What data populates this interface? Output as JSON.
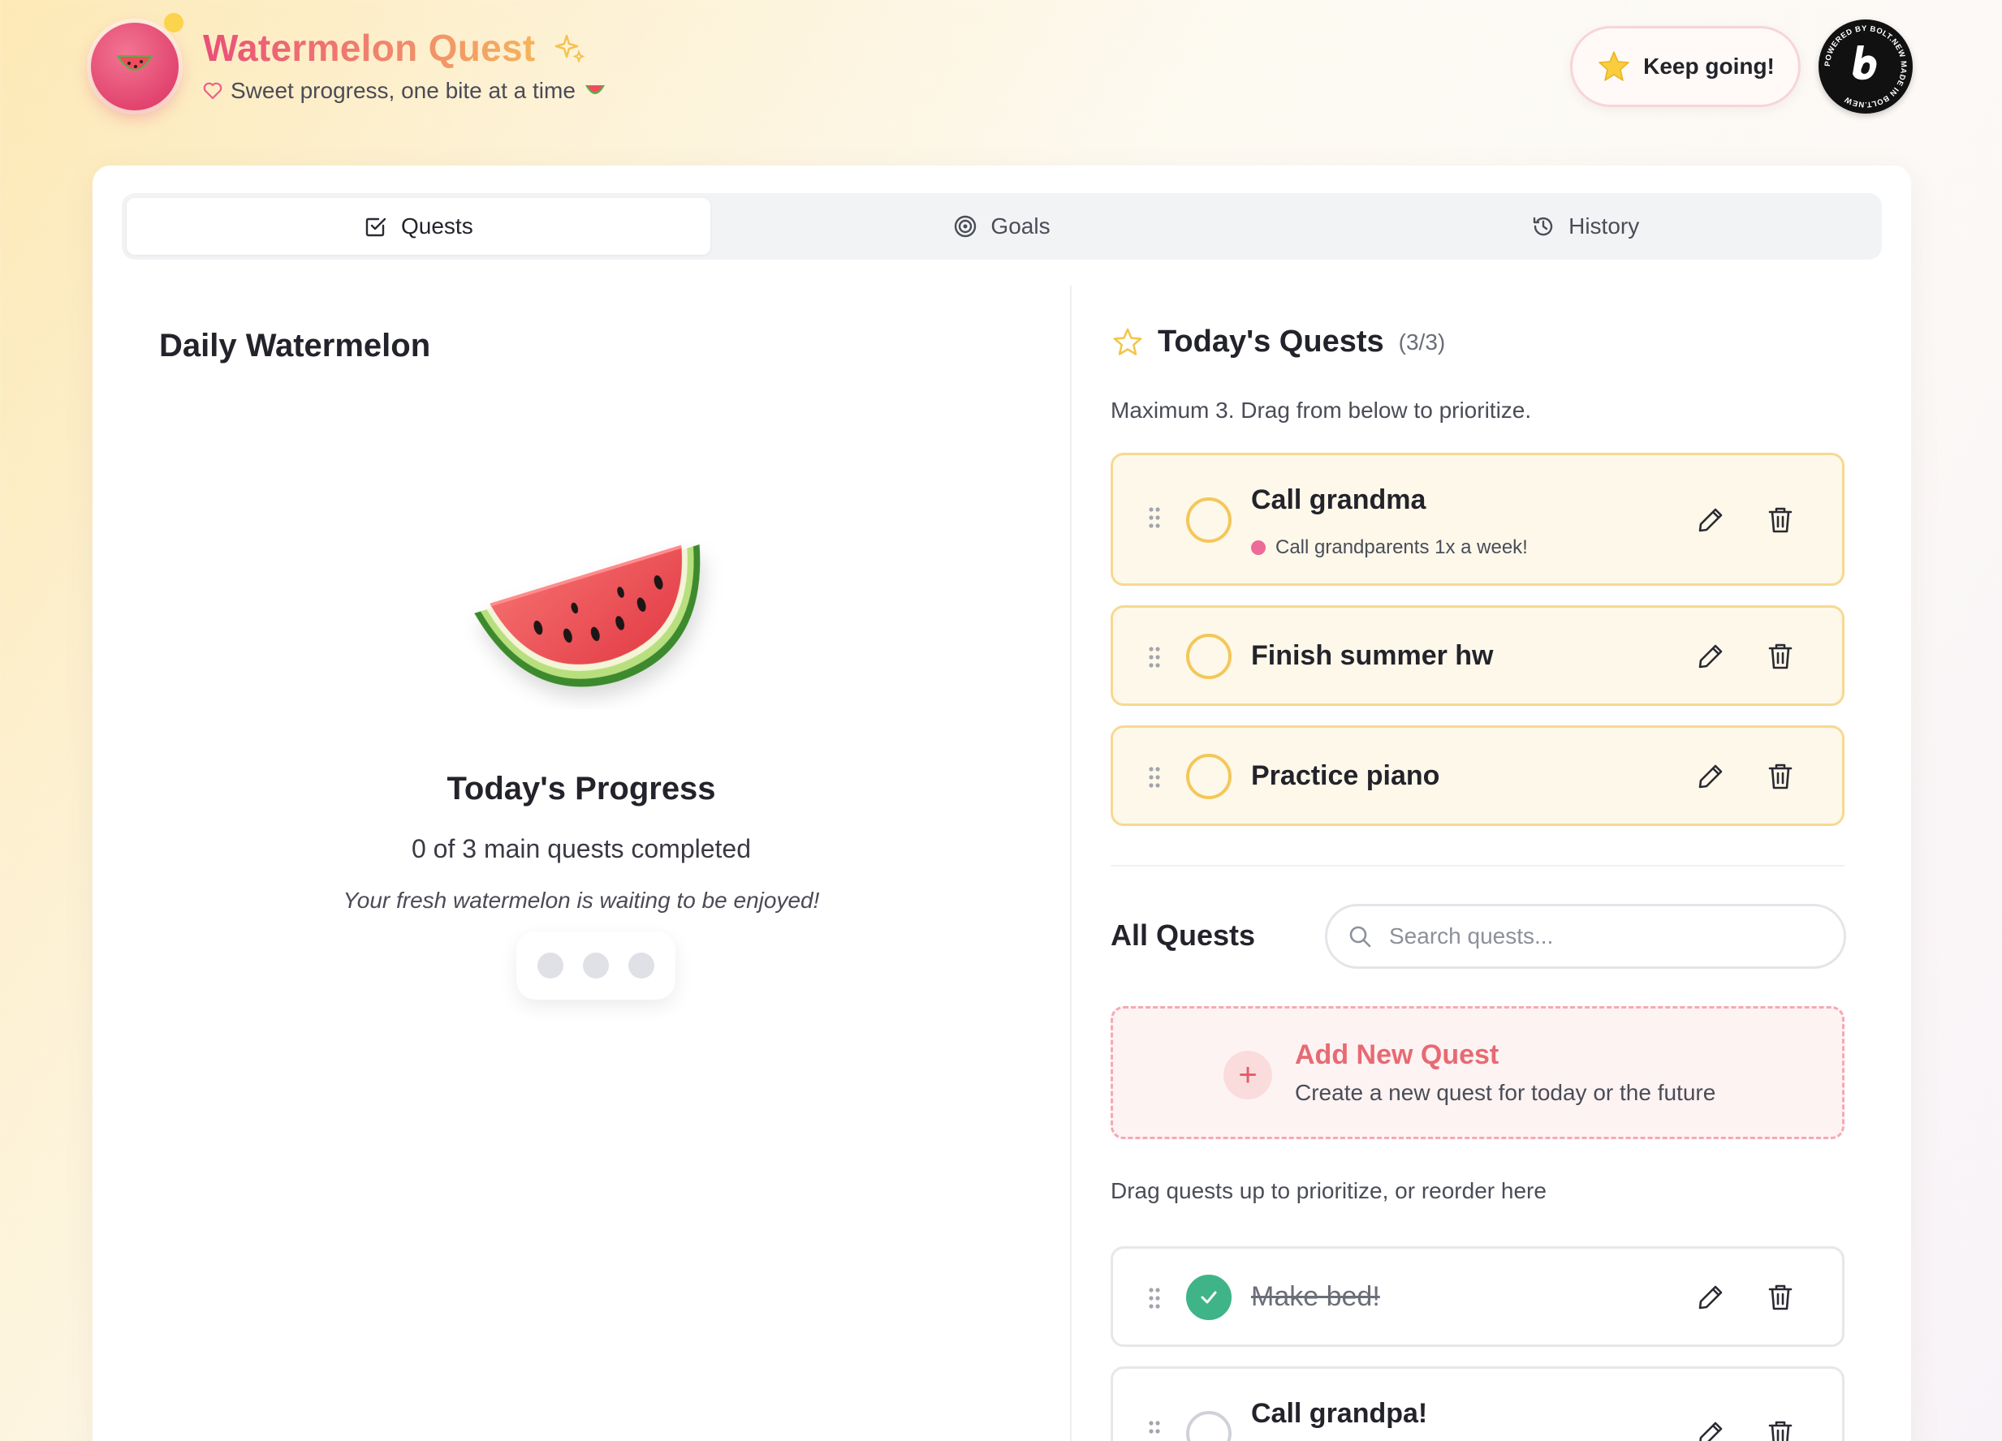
{
  "header": {
    "title": "Watermelon Quest",
    "subtitle": "Sweet progress, one bite at a time",
    "keep_going": "Keep going!",
    "badge_text": "POWERED BY BOLT.NEW MADE IN BOLT.NEW"
  },
  "tabs": [
    {
      "label": "Quests",
      "icon": "checkbox-icon",
      "active": true
    },
    {
      "label": "Goals",
      "icon": "target-icon",
      "active": false
    },
    {
      "label": "History",
      "icon": "history-icon",
      "active": false
    }
  ],
  "left": {
    "title": "Daily Watermelon",
    "progress_title": "Today's Progress",
    "progress_count": "0 of 3 main quests completed",
    "progress_message": "Your fresh watermelon is waiting to be enjoyed!",
    "completed": 0,
    "total": 3
  },
  "todays_quests": {
    "title": "Today's Quests",
    "count": "(3/3)",
    "hint": "Maximum 3. Drag from below to prioritize.",
    "items": [
      {
        "name": "Call grandma",
        "goal": "Call grandparents 1x a week!",
        "done": false
      },
      {
        "name": "Finish summer hw",
        "done": false
      },
      {
        "name": "Practice piano",
        "done": false
      }
    ]
  },
  "all_quests": {
    "title": "All Quests",
    "search_placeholder": "Search quests...",
    "add_title": "Add New Quest",
    "add_subtitle": "Create a new quest for today or the future",
    "drag_hint": "Drag quests up to prioritize, or reorder here",
    "items": [
      {
        "name": "Make bed!",
        "done": true
      },
      {
        "name": "Call grandpa!",
        "done": false
      }
    ]
  },
  "colors": {
    "accent_pink": "#ea4f7a",
    "accent_yellow": "#f3c75a",
    "done_green": "#3fb488"
  }
}
